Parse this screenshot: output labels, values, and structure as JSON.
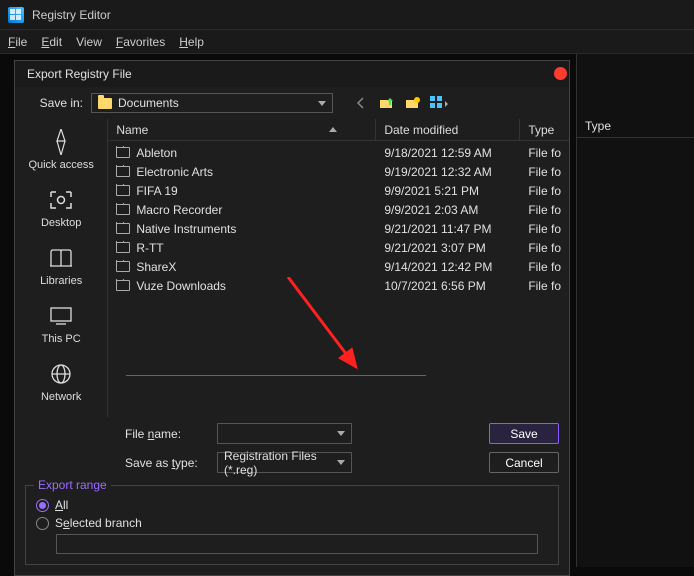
{
  "titlebar": {
    "title": "Registry Editor"
  },
  "menubar": {
    "file": "File",
    "edit": "Edit",
    "view": "View",
    "favorites": "Favorites",
    "help": "Help"
  },
  "dialog": {
    "title": "Export Registry File",
    "save_in_label": "Save in:",
    "save_in_value": "Documents",
    "places": {
      "quick_access": "Quick access",
      "desktop": "Desktop",
      "libraries": "Libraries",
      "this_pc": "This PC",
      "network": "Network"
    },
    "columns": {
      "name": "Name",
      "date": "Date modified",
      "type": "Type"
    },
    "files": [
      {
        "name": "Ableton",
        "date": "9/18/2021 12:59 AM",
        "type": "File fo"
      },
      {
        "name": "Electronic Arts",
        "date": "9/19/2021 12:32 AM",
        "type": "File fo"
      },
      {
        "name": "FIFA 19",
        "date": "9/9/2021 5:21 PM",
        "type": "File fo"
      },
      {
        "name": "Macro Recorder",
        "date": "9/9/2021 2:03 AM",
        "type": "File fo"
      },
      {
        "name": "Native Instruments",
        "date": "9/21/2021 11:47 PM",
        "type": "File fo"
      },
      {
        "name": "R-TT",
        "date": "9/21/2021 3:07 PM",
        "type": "File fo"
      },
      {
        "name": "ShareX",
        "date": "9/14/2021 12:42 PM",
        "type": "File fo"
      },
      {
        "name": "Vuze Downloads",
        "date": "10/7/2021 6:56 PM",
        "type": "File fo"
      }
    ],
    "file_name_label": "File name:",
    "file_name_value": "",
    "save_as_type_label": "Save as type:",
    "save_as_type_value": "Registration Files (*.reg)",
    "save_button": "Save",
    "cancel_button": "Cancel",
    "export_range": {
      "legend": "Export range",
      "all": "All",
      "selected_branch": "Selected branch",
      "branch_value": ""
    }
  },
  "right_panel": {
    "type_col": "Type"
  }
}
